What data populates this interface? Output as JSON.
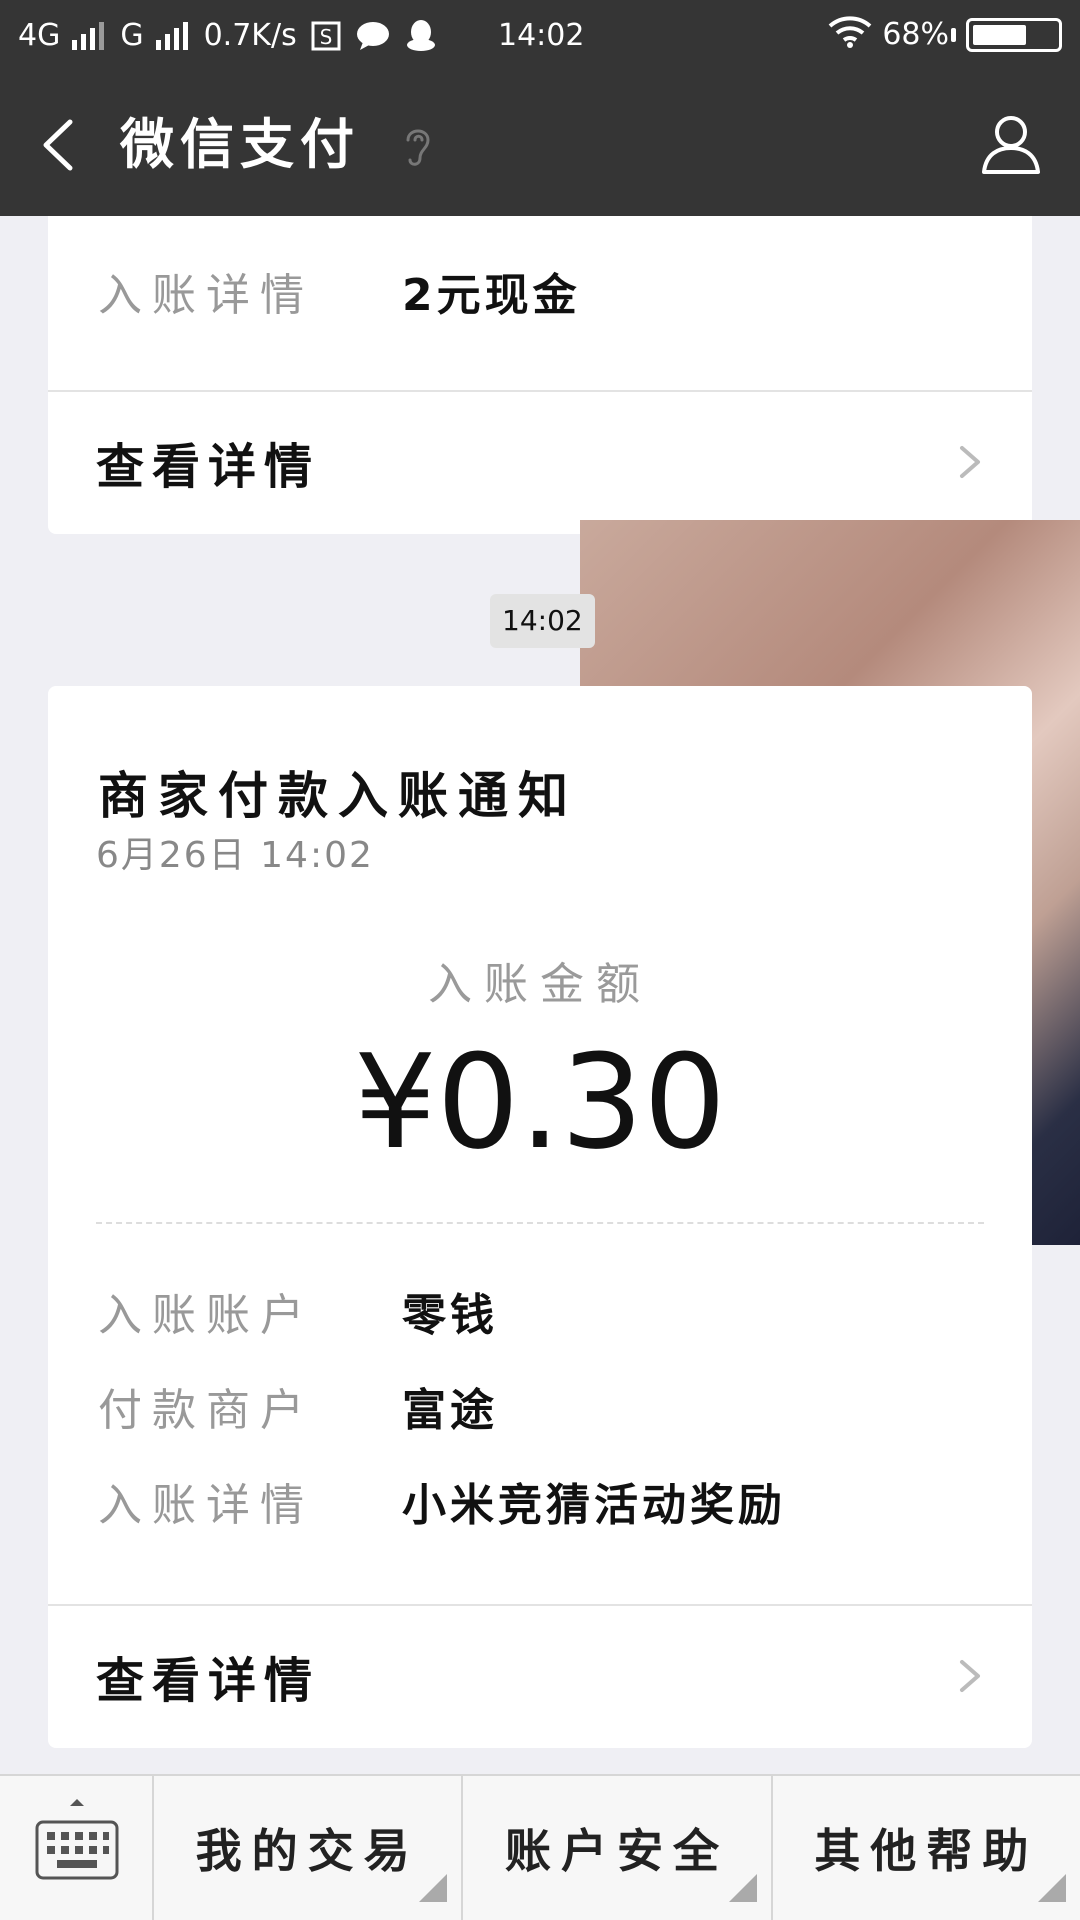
{
  "status_bar": {
    "network1": "4G",
    "network2": "G",
    "speed": "0.7K/s",
    "time": "14:02",
    "battery": "68%",
    "battery_level": 0.68
  },
  "nav": {
    "title": "微信支付"
  },
  "prev_card": {
    "detail_label": "入账详情",
    "detail_value": "2元现金",
    "view_details": "查看详情"
  },
  "timestamp": "14:02",
  "notification": {
    "title": "商家付款入账通知",
    "date": "6月26日  14:02",
    "amount_label": "入账金额",
    "amount": "¥0.30",
    "rows": [
      {
        "label": "入账账户",
        "value": "零钱"
      },
      {
        "label": "付款商户",
        "value": "富途"
      },
      {
        "label": "入账详情",
        "value": "小米竞猜活动奖励"
      }
    ],
    "view_details": "查看详情"
  },
  "bottom_menu": {
    "items": [
      "我的交易",
      "账户安全",
      "其他帮助"
    ]
  },
  "colors": {
    "bar_bg": "#353535",
    "page_bg": "#efeff4"
  }
}
